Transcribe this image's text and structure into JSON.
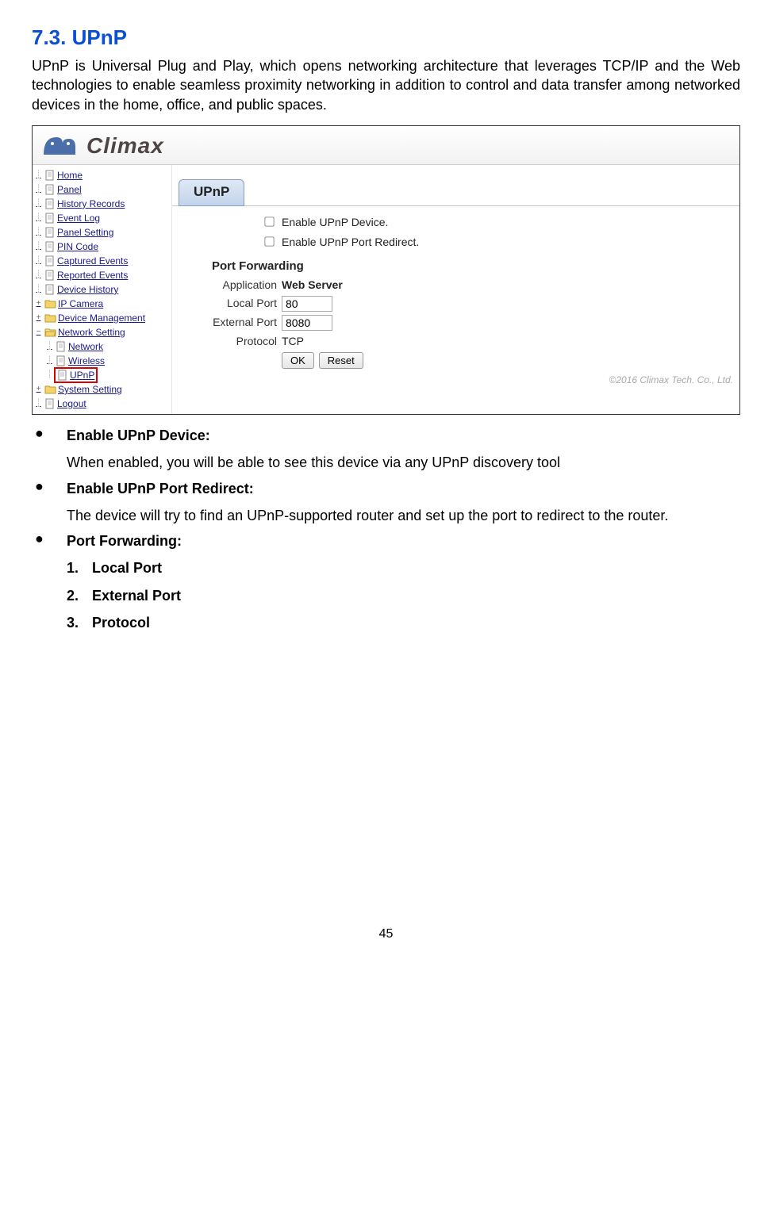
{
  "section": {
    "number": "7.3.",
    "title": "UPnP",
    "intro": "UPnP is Universal Plug and Play, which opens networking architecture that leverages TCP/IP and the Web technologies to enable seamless proximity networking in addition to control and data transfer among networked devices in the home, office, and public spaces."
  },
  "screenshot": {
    "logo_text": "Climax",
    "nav": {
      "items": [
        {
          "label": "Home",
          "type": "doc",
          "indent": 0,
          "exp": ""
        },
        {
          "label": "Panel",
          "type": "doc",
          "indent": 0,
          "exp": ""
        },
        {
          "label": "History Records",
          "type": "doc",
          "indent": 0,
          "exp": ""
        },
        {
          "label": "Event Log",
          "type": "doc",
          "indent": 0,
          "exp": ""
        },
        {
          "label": "Panel Setting",
          "type": "doc",
          "indent": 0,
          "exp": ""
        },
        {
          "label": "PIN Code",
          "type": "doc",
          "indent": 0,
          "exp": ""
        },
        {
          "label": "Captured Events",
          "type": "doc",
          "indent": 0,
          "exp": ""
        },
        {
          "label": "Reported Events",
          "type": "doc",
          "indent": 0,
          "exp": ""
        },
        {
          "label": "Device History",
          "type": "doc",
          "indent": 0,
          "exp": ""
        },
        {
          "label": "IP Camera",
          "type": "folder",
          "indent": 0,
          "exp": "+"
        },
        {
          "label": "Device Management",
          "type": "folder",
          "indent": 0,
          "exp": "+"
        },
        {
          "label": "Network Setting",
          "type": "folder",
          "indent": 0,
          "exp": "−"
        },
        {
          "label": "Network",
          "type": "doc",
          "indent": 1,
          "exp": ""
        },
        {
          "label": "Wireless",
          "type": "doc",
          "indent": 1,
          "exp": ""
        },
        {
          "label": "UPnP",
          "type": "doc",
          "indent": 1,
          "exp": "",
          "selected": true
        },
        {
          "label": "System Setting",
          "type": "folder",
          "indent": 0,
          "exp": "+"
        },
        {
          "label": "Logout",
          "type": "doc",
          "indent": 0,
          "exp": ""
        }
      ]
    },
    "tab_title": "UPnP",
    "checkboxes": {
      "enable_device": "Enable UPnP Device.",
      "enable_redirect": "Enable UPnP Port Redirect."
    },
    "port_forwarding": {
      "heading": "Port Forwarding",
      "application_label": "Application",
      "application_value": "Web Server",
      "local_port_label": "Local Port",
      "local_port_value": "80",
      "external_port_label": "External Port",
      "external_port_value": "8080",
      "protocol_label": "Protocol",
      "protocol_value": "TCP",
      "ok_btn": "OK",
      "reset_btn": "Reset"
    },
    "copyright": "©2016 Climax Tech. Co., Ltd."
  },
  "bullets": {
    "b1_title": "Enable UPnP Device:",
    "b1_desc": "When enabled, you will be able to see this device via any UPnP discovery tool",
    "b2_title": "Enable UPnP Port Redirect:",
    "b2_desc": "The device will try to find an UPnP-supported router and set up the port to redirect to the router.",
    "b3_title": "Port Forwarding:",
    "n1": "Local Port",
    "n2": "External Port",
    "n3": "Protocol"
  },
  "page_number": "45"
}
